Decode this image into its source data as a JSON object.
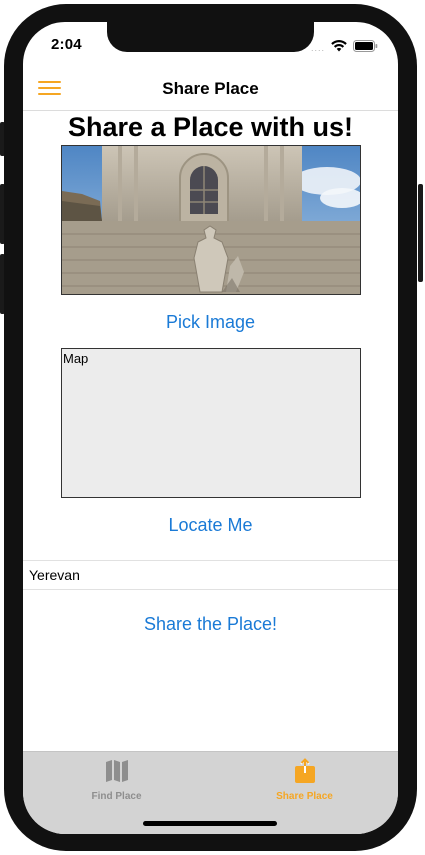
{
  "status_bar": {
    "time": "2:04",
    "signal": "....",
    "icons": [
      "wifi-icon",
      "battery-icon"
    ]
  },
  "nav": {
    "title": "Share Place",
    "menu_icon": "hamburger-menu-icon",
    "accent_color": "#f5a623"
  },
  "form": {
    "heading": "Share a Place with us!",
    "pick_image_label": "Pick Image",
    "map_label": "Map",
    "locate_me_label": "Locate Me",
    "address_value": "Yerevan",
    "share_button_label": "Share the Place!",
    "link_color": "#1a7ad6"
  },
  "tabs": [
    {
      "label": "Find Place",
      "icon": "map-icon",
      "active": false,
      "color": "#8e8e8e"
    },
    {
      "label": "Share Place",
      "icon": "share-icon",
      "active": true,
      "color": "#f5a623"
    }
  ]
}
